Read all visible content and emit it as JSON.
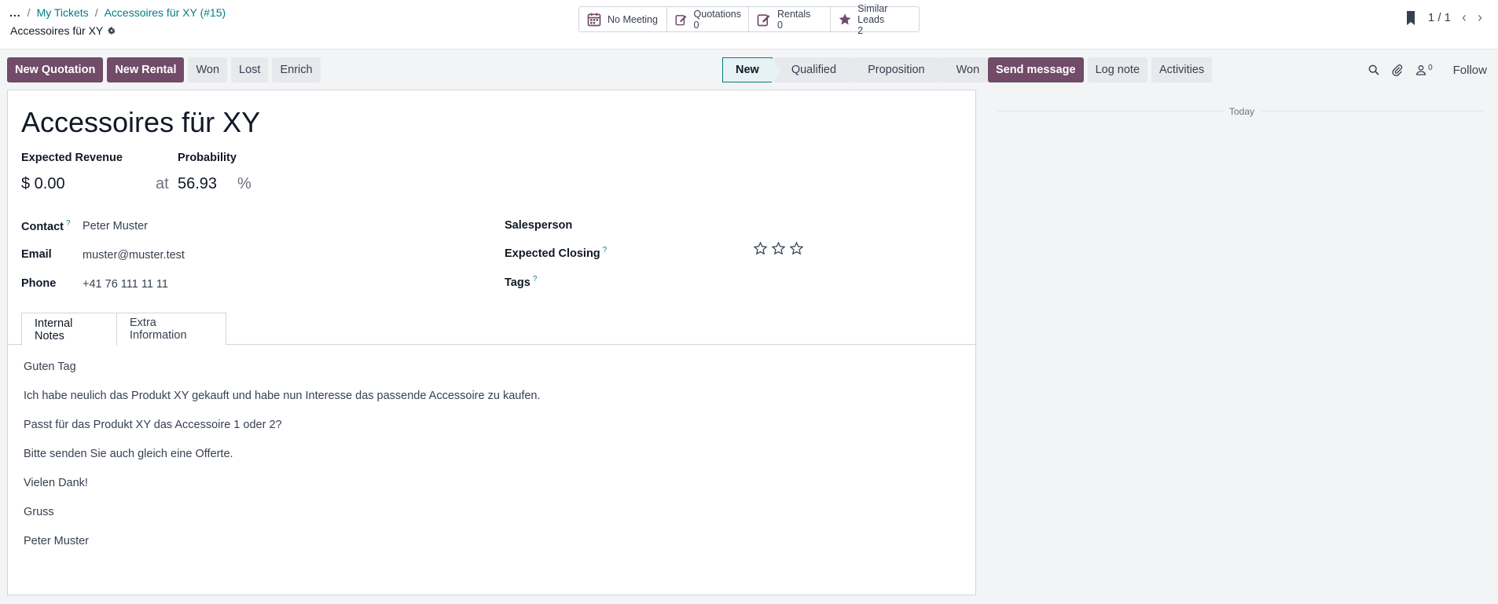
{
  "breadcrumb": {
    "dots": "...",
    "items": [
      "My Tickets",
      "Accessoires für XY (#15)"
    ]
  },
  "record_title": "Accessoires für XY",
  "smart_buttons": {
    "meeting": {
      "label": "No Meeting"
    },
    "quotations": {
      "label": "Quotations",
      "count": "0"
    },
    "rentals": {
      "label": "Rentals",
      "count": "0"
    },
    "similar_leads": {
      "label": "Similar Leads",
      "count": "2"
    }
  },
  "pager": {
    "value": "1 / 1",
    "prev": "‹",
    "next": "›"
  },
  "actions": {
    "new_quotation": "New Quotation",
    "new_rental": "New Rental",
    "won": "Won",
    "lost": "Lost",
    "enrich": "Enrich"
  },
  "stages": [
    "New",
    "Qualified",
    "Proposition",
    "Won"
  ],
  "active_stage": "New",
  "chatter": {
    "send_message": "Send message",
    "log_note": "Log note",
    "activities": "Activities",
    "followers_count": "0",
    "follow": "Follow",
    "today": "Today"
  },
  "form": {
    "lead_name": "Accessoires für XY",
    "expected_revenue_label": "Expected Revenue",
    "probability_label": "Probability",
    "expected_revenue": "$ 0.00",
    "at": "at",
    "probability": "56.93",
    "percent": "%",
    "contact_label": "Contact",
    "contact": "Peter Muster",
    "email_label": "Email",
    "email": "muster@muster.test",
    "phone_label": "Phone",
    "phone": "+41 76 111 11 11",
    "salesperson_label": "Salesperson",
    "expected_closing_label": "Expected Closing",
    "tags_label": "Tags",
    "help_mark": "?",
    "priority_stars": 0
  },
  "tabs": [
    "Internal Notes",
    "Extra Information"
  ],
  "notes": [
    "Guten Tag",
    "Ich habe neulich das Produkt XY gekauft und habe nun Interesse das passende Accessoire zu kaufen.",
    "Passt für das Produkt XY das Accessoire 1 oder 2?",
    "Bitte senden Sie auch gleich eine Offerte.",
    "Vielen Dank!",
    "Gruss",
    "Peter Muster"
  ],
  "colors": {
    "primary": "#714b67",
    "link": "#017e84",
    "secondary_bg": "#e7e9ed"
  }
}
